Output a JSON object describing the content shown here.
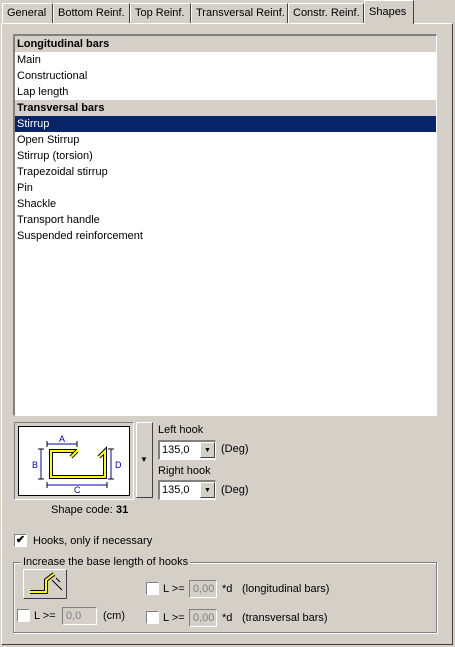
{
  "tabs": [
    {
      "label": "General"
    },
    {
      "label": "Bottom Reinf."
    },
    {
      "label": "Top Reinf."
    },
    {
      "label": "Transversal Reinf."
    },
    {
      "label": "Constr. Reinf."
    },
    {
      "label": "Shapes",
      "active": true
    }
  ],
  "list": {
    "items": [
      {
        "label": "Longitudinal bars",
        "type": "header"
      },
      {
        "label": "Main"
      },
      {
        "label": "Constructional"
      },
      {
        "label": "Lap length"
      },
      {
        "label": "Transversal bars",
        "type": "header"
      },
      {
        "label": "Stirrup",
        "selected": true
      },
      {
        "label": "Open Stirrup"
      },
      {
        "label": "Stirrup (torsion)"
      },
      {
        "label": "Trapezoidal stirrup"
      },
      {
        "label": "Pin"
      },
      {
        "label": "Shackle"
      },
      {
        "label": "Transport handle"
      },
      {
        "label": "Suspended reinforcement"
      }
    ]
  },
  "shape_preview": {
    "labels": {
      "a": "A",
      "b": "B",
      "c": "C",
      "d": "D"
    }
  },
  "hooks": {
    "left_label": "Left hook",
    "left_value": "135,0",
    "right_label": "Right hook",
    "right_value": "135,0",
    "unit": "(Deg)"
  },
  "shape_code": {
    "label": "Shape code:",
    "value": "31"
  },
  "hooks_if_necessary": {
    "label": "Hooks, only if necessary",
    "checked": true
  },
  "increase_group": {
    "title": "Increase the base length of hooks",
    "l_prefix": "L >=",
    "cm": {
      "value": "0,0",
      "unit": "(cm)",
      "checked": false
    },
    "long": {
      "value": "0,00",
      "unit": "*d",
      "desc": "(longitudinal bars)",
      "checked": false
    },
    "trans": {
      "value": "0,00",
      "unit": "*d",
      "desc": "(transversal bars)",
      "checked": false
    }
  },
  "colors": {
    "selection": "#0a246a",
    "shape_stroke": "#ffff00",
    "dimension": "#0000aa"
  }
}
